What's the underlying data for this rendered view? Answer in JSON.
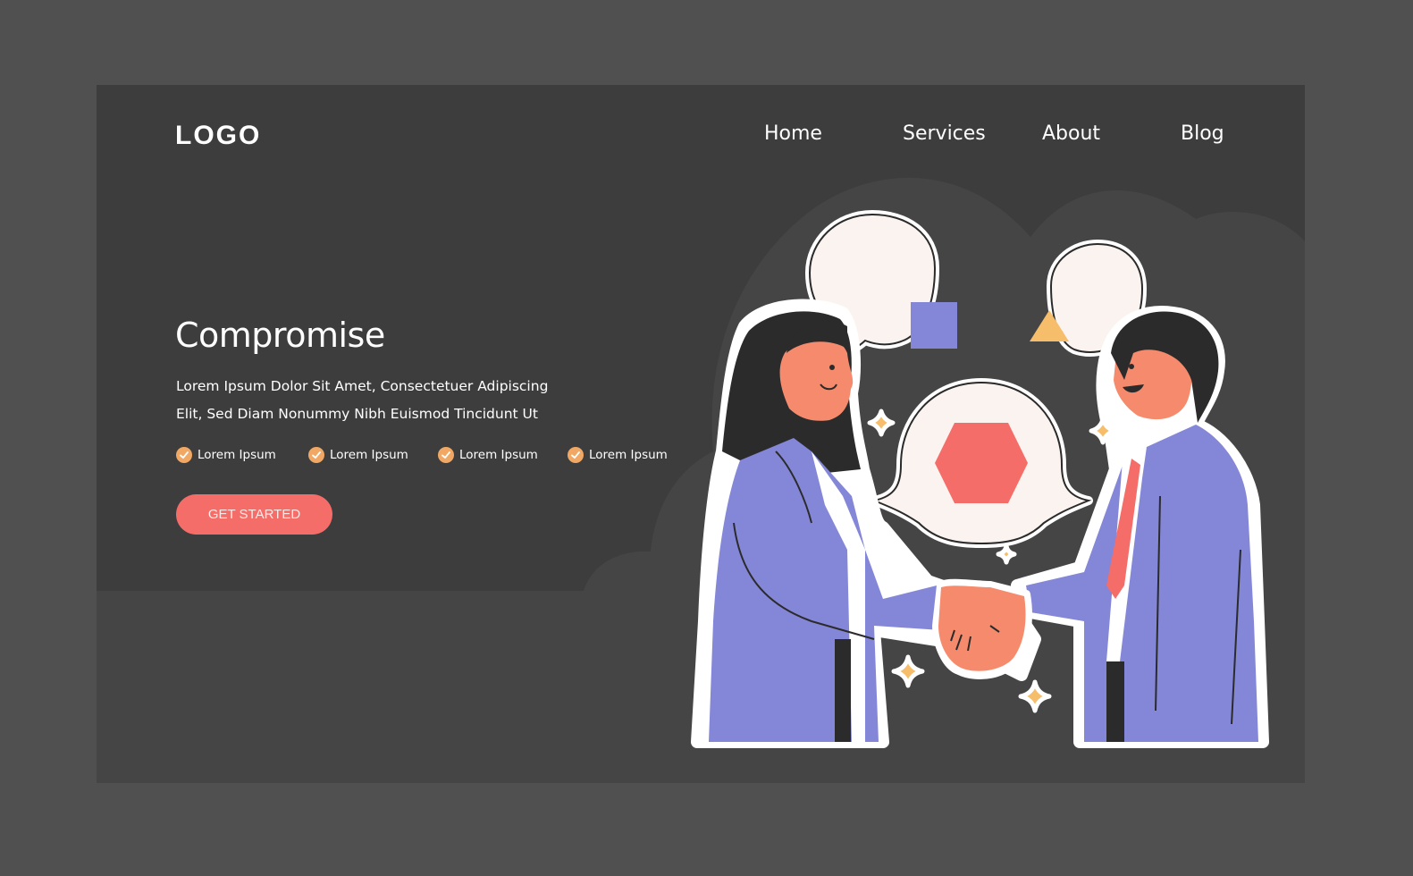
{
  "header": {
    "logo": "LOGO",
    "nav": [
      {
        "label": "Home"
      },
      {
        "label": "Services"
      },
      {
        "label": "About"
      },
      {
        "label": "Blog"
      }
    ]
  },
  "hero": {
    "title": "Compromise",
    "description": "Lorem Ipsum Dolor Sit Amet, Consectetuer Adipiscing Elit, Sed Diam Nonummy Nibh Euismod Tincidunt Ut",
    "features": [
      {
        "label": "Lorem Ipsum",
        "icon": "check-circle-icon"
      },
      {
        "label": "Lorem Ipsum",
        "icon": "check-circle-icon"
      },
      {
        "label": "Lorem Ipsum",
        "icon": "check-circle-icon"
      },
      {
        "label": "Lorem Ipsum",
        "icon": "check-circle-icon"
      }
    ],
    "cta_label": "GET STARTED"
  },
  "illustration": {
    "subject": "two business people shaking hands with speech bubbles",
    "bubbles": [
      "square",
      "triangle",
      "hexagon"
    ]
  },
  "colors": {
    "page_bg": "#505050",
    "card_bg": "#3d3d3d",
    "cloud_bg": "#454545",
    "accent_coral": "#f56d69",
    "accent_orange": "#f1a865",
    "suit_purple": "#8487d8",
    "shape_yellow": "#f6bd6a",
    "skin": "#f58b6c",
    "hair": "#2b2b2b"
  }
}
